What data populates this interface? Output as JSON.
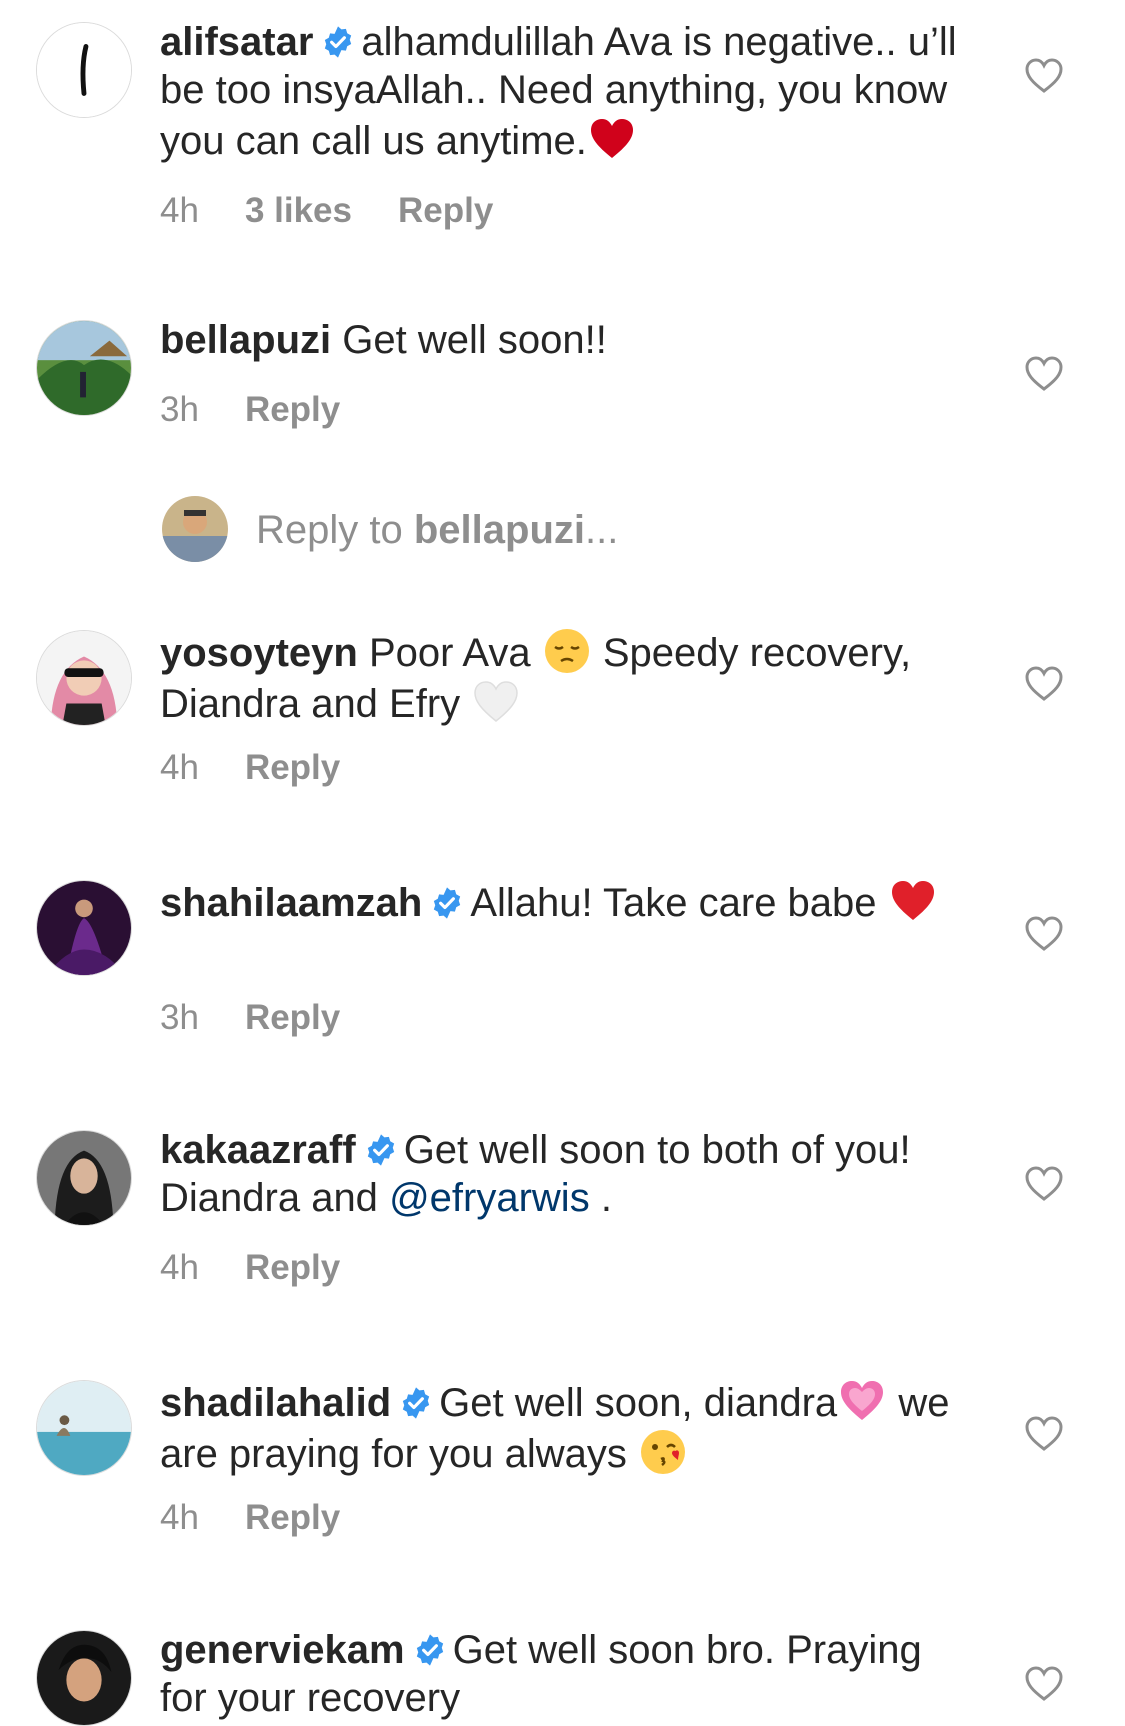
{
  "comments": [
    {
      "username": "alifsatar",
      "verified": true,
      "text_before": "alhamdulillah Ava is negative.. u’ll be too insyaAllah.. Need anything, you know you can call us anytime.",
      "mention": "",
      "text_after": "",
      "emojis": [
        "red-heart"
      ],
      "time": "4h",
      "likes": "3 likes",
      "reply_label": "Reply"
    },
    {
      "username": "bellapuzi",
      "verified": false,
      "text_before": "Get well soon!!",
      "mention": "",
      "text_after": "",
      "emojis": [],
      "time": "3h",
      "likes": "",
      "reply_label": "Reply"
    },
    {
      "username": "yosoyteyn",
      "verified": false,
      "text_before": "Poor Ava",
      "mention": "",
      "text_middle": "Speedy recovery, Diandra and Efry",
      "text_after": "",
      "emojis": [
        "pensive-face",
        "white-heart"
      ],
      "time": "4h",
      "likes": "",
      "reply_label": "Reply"
    },
    {
      "username": "shahilaamzah",
      "verified": true,
      "text_before": "Allahu! Take care babe",
      "mention": "",
      "text_after": "",
      "emojis": [
        "red-heart"
      ],
      "time": "3h",
      "likes": "",
      "reply_label": "Reply"
    },
    {
      "username": "kakaazraff",
      "verified": true,
      "text_before": "Get well soon to both of you! Diandra and",
      "mention": "@efryarwis",
      "text_after": ".",
      "emojis": [],
      "time": "4h",
      "likes": "",
      "reply_label": "Reply"
    },
    {
      "username": "shadilahalid",
      "verified": true,
      "text_before": "Get well soon, diandra",
      "mention": "",
      "text_middle": "we are praying for you always",
      "text_after": "",
      "emojis": [
        "growing-heart",
        "kissing-face"
      ],
      "time": "4h",
      "likes": "",
      "reply_label": "Reply"
    },
    {
      "username": "generviekam",
      "verified": true,
      "text_before": "Get well soon bro. Praying for your recovery",
      "mention": "",
      "text_after": "",
      "emojis": [],
      "time": "",
      "likes": "",
      "reply_label": ""
    }
  ],
  "reply_composer": {
    "prefix": "Reply to",
    "target": "bellapuzi",
    "suffix": "..."
  },
  "colors": {
    "text": "#262626",
    "meta": "#8e8e8e",
    "verified": "#3897f0",
    "mention": "#00376b"
  },
  "icons": {
    "like": "heart-outline-icon",
    "verified": "verified-badge-icon"
  }
}
